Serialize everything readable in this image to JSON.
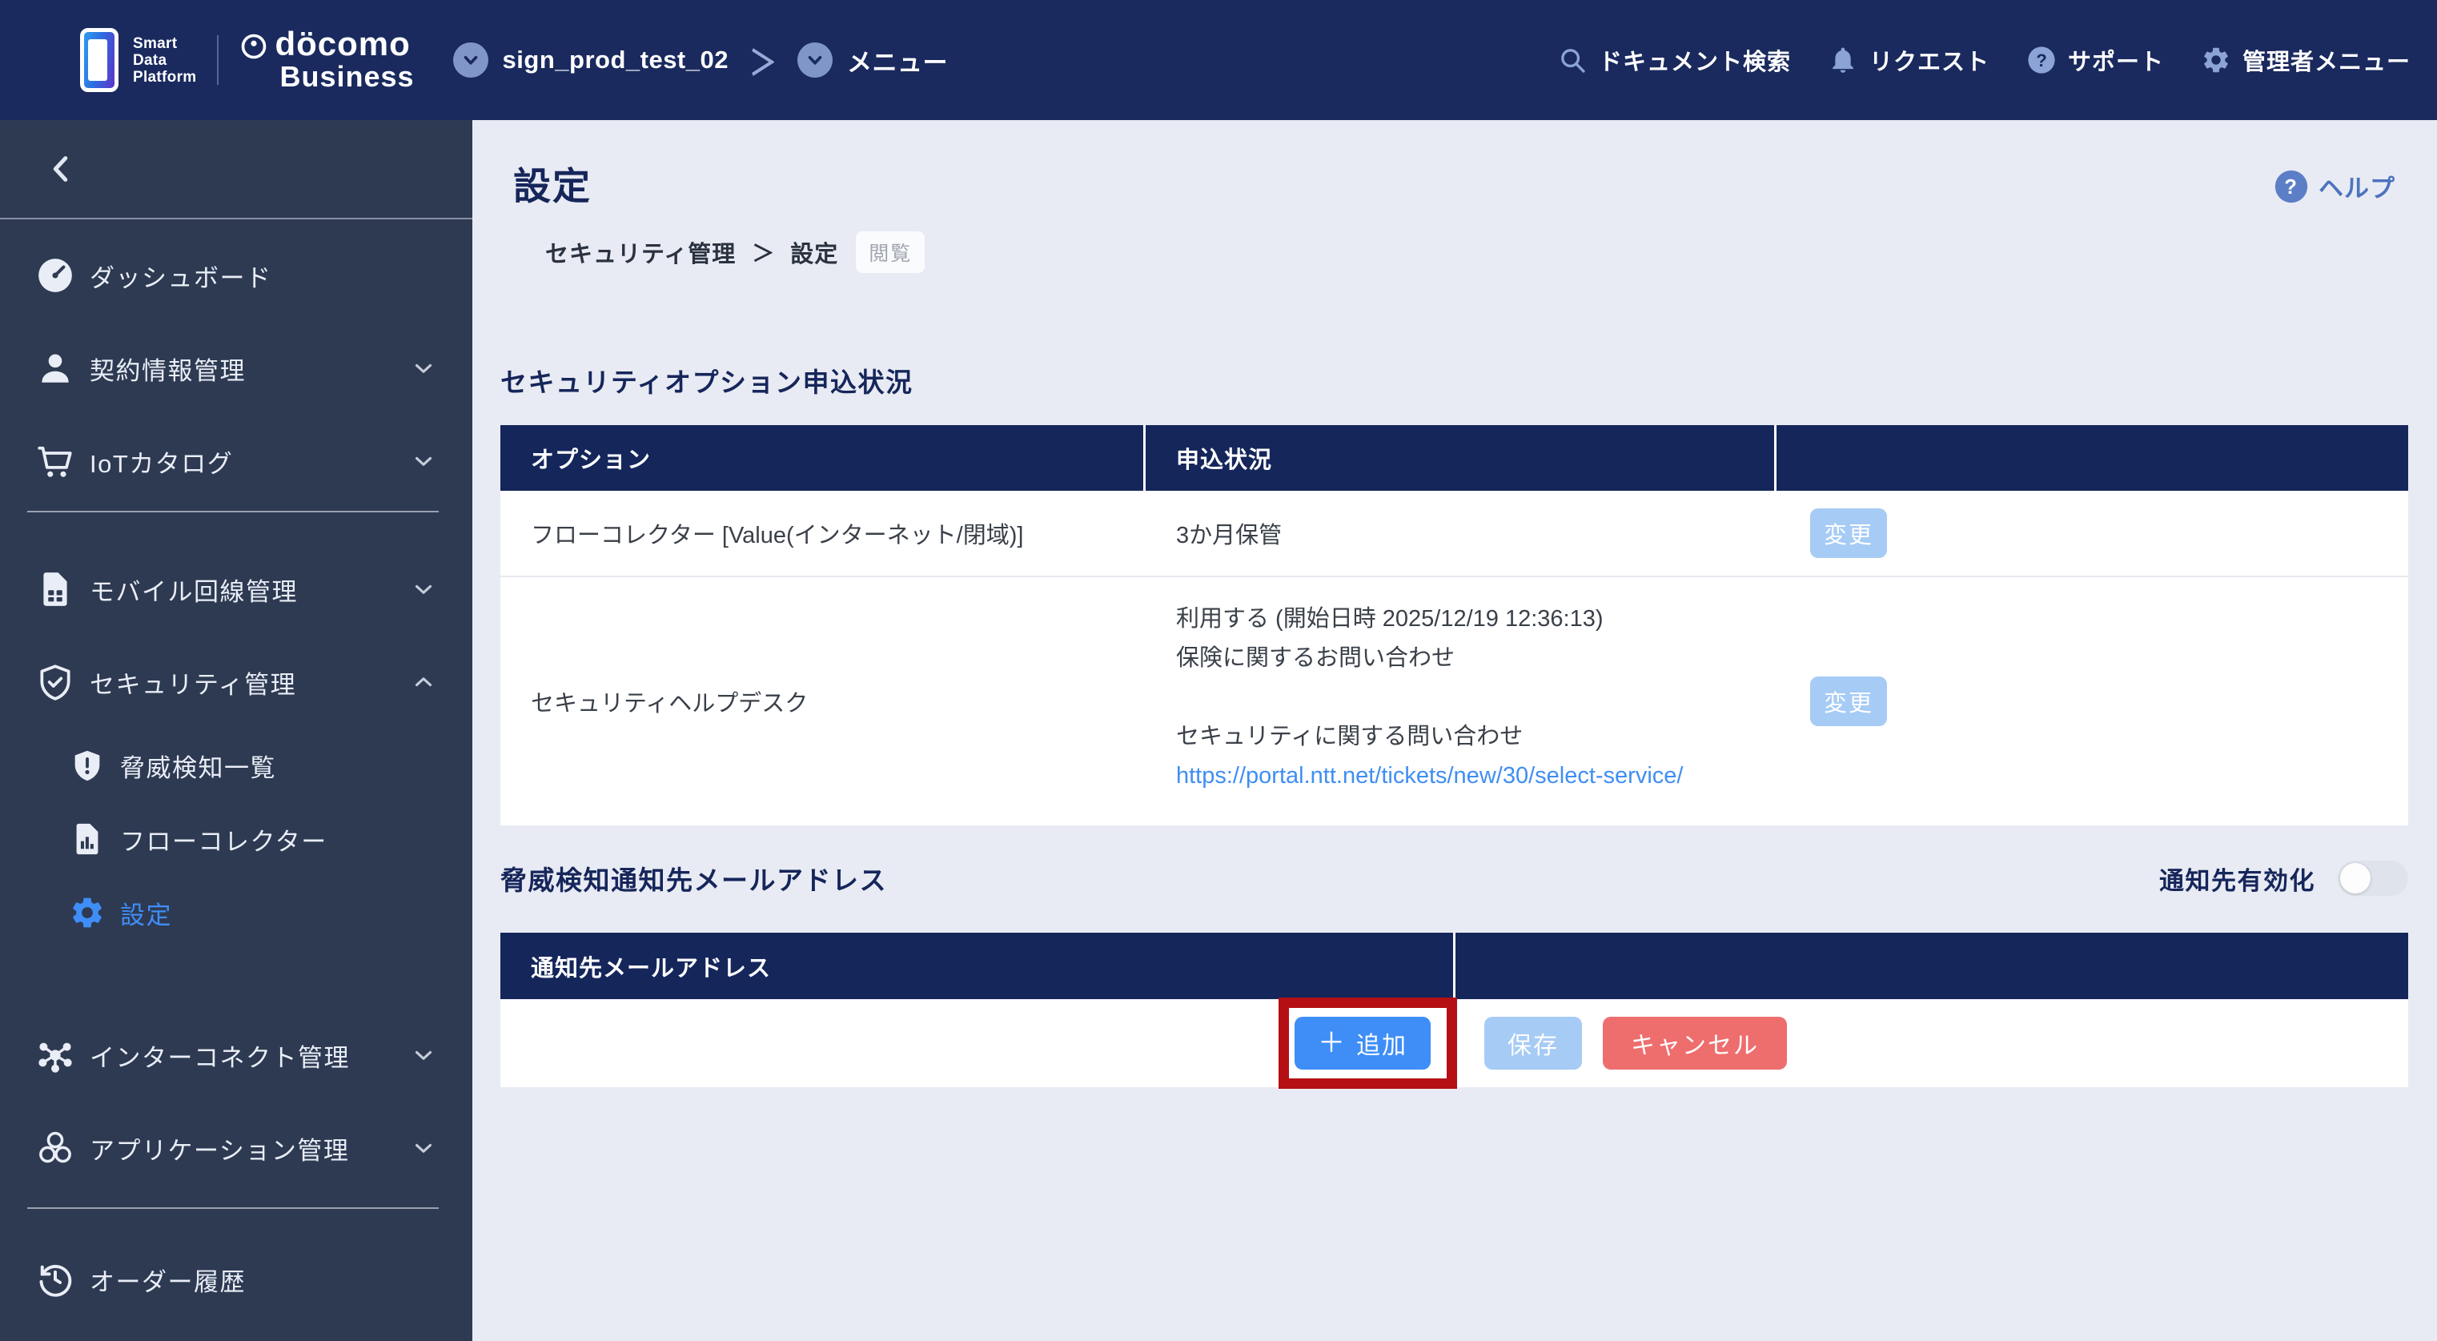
{
  "colors": {
    "header_bg": "#1A2A5E",
    "sidebar_bg": "#2E3A52",
    "table_header_bg": "#15265B",
    "page_bg": "#E8EBF3",
    "accent_blue": "#3F8EF7",
    "light_blue_button": "#A6CBF5",
    "cancel_red": "#EE6E6E",
    "annotation_red": "#B50F14",
    "link_blue": "#3F8EF3"
  },
  "header": {
    "logo": {
      "product_line1": "Smart",
      "product_line2": "Data",
      "product_line3": "Platform",
      "brand_top": "döcomo",
      "brand_bottom": "Business"
    },
    "workspace": "sign_prod_test_02",
    "workspace_separator": "＞",
    "menu_label": "メニュー",
    "actions": [
      {
        "label": "ドキュメント検索"
      },
      {
        "label": "リクエスト"
      },
      {
        "label": "サポート"
      },
      {
        "label": "管理者メニュー"
      }
    ]
  },
  "sidebar": {
    "items": [
      {
        "label": "ダッシュボード"
      },
      {
        "label": "契約情報管理"
      },
      {
        "label": "IoTカタログ"
      },
      {
        "label": "モバイル回線管理"
      },
      {
        "label": "セキュリティ管理"
      },
      {
        "label": "脅威検知一覧"
      },
      {
        "label": "フローコレクター"
      },
      {
        "label": "設定"
      },
      {
        "label": "インターコネクト管理"
      },
      {
        "label": "アプリケーション管理"
      },
      {
        "label": "オーダー履歴"
      }
    ]
  },
  "main": {
    "page_title": "設定",
    "help_label": "ヘルプ",
    "breadcrumb": {
      "item1": "セキュリティ管理",
      "separator": "＞",
      "item2": "設定",
      "badge": "閲覧"
    },
    "section1": {
      "title": "セキュリティオプション申込状況",
      "col1": "オプション",
      "col2": "申込状況",
      "col3": "",
      "rows": [
        {
          "option": "フローコレクター [Value(インターネット/閉域)]",
          "status": "3か月保管",
          "action": "変更"
        },
        {
          "option": "セキュリティヘルプデスク",
          "status_lines": [
            "利用する (開始日時 2025/12/19 12:36:13)",
            "保険に関するお問い合わせ",
            "",
            "セキュリティに関する問い合わせ"
          ],
          "link": "https://portal.ntt.net/tickets/new/30/select-service/",
          "action": "変更"
        }
      ]
    },
    "section2": {
      "title": "脅威検知通知先メールアドレス",
      "toggle_label": "通知先有効化",
      "toggle_state": "off",
      "col1": "通知先メールアドレス",
      "col2": "",
      "buttons": {
        "add_icon": "＋",
        "add": "追加",
        "save": "保存",
        "cancel": "キャンセル"
      }
    }
  }
}
